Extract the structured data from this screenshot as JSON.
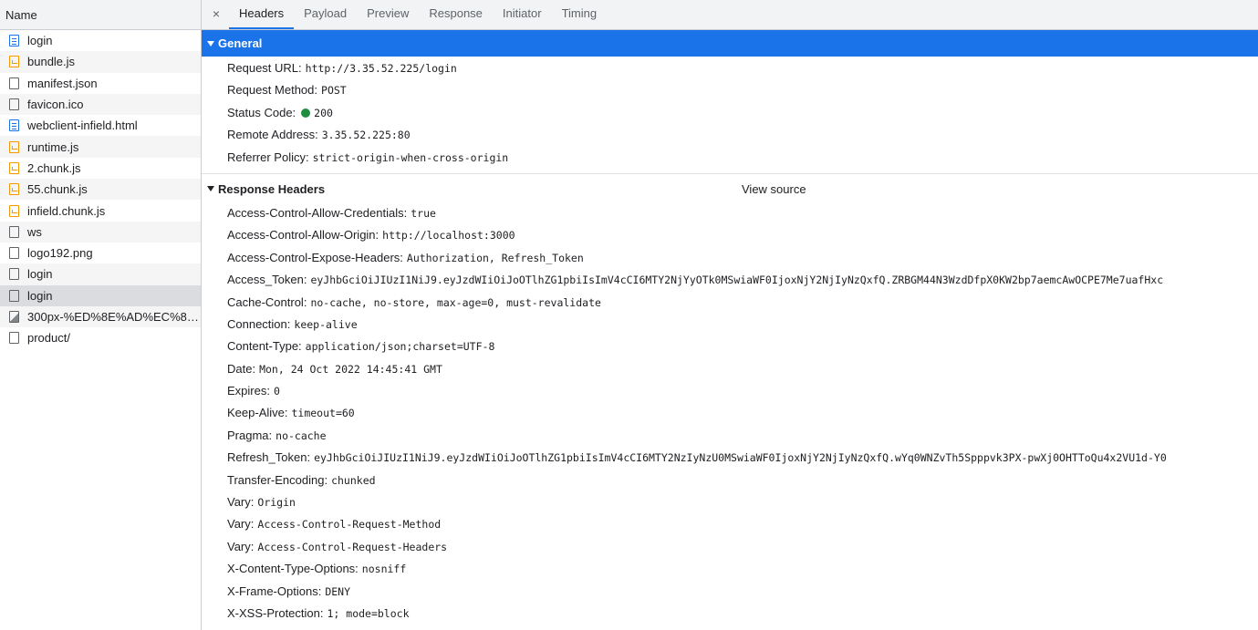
{
  "left": {
    "header": "Name",
    "items": [
      {
        "name": "login",
        "type": "doc"
      },
      {
        "name": "bundle.js",
        "type": "js"
      },
      {
        "name": "manifest.json",
        "type": "blank"
      },
      {
        "name": "favicon.ico",
        "type": "blank"
      },
      {
        "name": "webclient-infield.html",
        "type": "doc"
      },
      {
        "name": "runtime.js",
        "type": "js"
      },
      {
        "name": "2.chunk.js",
        "type": "js"
      },
      {
        "name": "55.chunk.js",
        "type": "js"
      },
      {
        "name": "infield.chunk.js",
        "type": "js"
      },
      {
        "name": "ws",
        "type": "blank"
      },
      {
        "name": "logo192.png",
        "type": "blank"
      },
      {
        "name": "login",
        "type": "blank"
      },
      {
        "name": "login",
        "type": "blank",
        "selected": true
      },
      {
        "name": "300px-%ED%8E%AD%EC%88...",
        "type": "img"
      },
      {
        "name": "product/",
        "type": "blank"
      }
    ]
  },
  "tabs": {
    "close": "×",
    "items": [
      "Headers",
      "Payload",
      "Preview",
      "Response",
      "Initiator",
      "Timing"
    ],
    "active": "Headers"
  },
  "general": {
    "title": "General",
    "rows": [
      {
        "k": "Request URL:",
        "v": "http://3.35.52.225/login"
      },
      {
        "k": "Request Method:",
        "v": "POST"
      },
      {
        "k": "Status Code:",
        "v": "200",
        "status_dot": true
      },
      {
        "k": "Remote Address:",
        "v": "3.35.52.225:80"
      },
      {
        "k": "Referrer Policy:",
        "v": "strict-origin-when-cross-origin"
      }
    ]
  },
  "response_headers": {
    "title": "Response Headers",
    "view_source": "View source",
    "rows": [
      {
        "k": "Access-Control-Allow-Credentials:",
        "v": "true"
      },
      {
        "k": "Access-Control-Allow-Origin:",
        "v": "http://localhost:3000"
      },
      {
        "k": "Access-Control-Expose-Headers:",
        "v": "Authorization, Refresh_Token"
      },
      {
        "k": "Access_Token:",
        "v": "eyJhbGciOiJIUzI1NiJ9.eyJzdWIiOiJoOTlhZG1pbiIsImV4cCI6MTY2NjYyOTk0MSwiaWF0IjoxNjY2NjIyNzQxfQ.ZRBGM44N3WzdDfpX0KW2bp7aemcAwOCPE7Me7uafHxc"
      },
      {
        "k": "Cache-Control:",
        "v": "no-cache, no-store, max-age=0, must-revalidate"
      },
      {
        "k": "Connection:",
        "v": "keep-alive"
      },
      {
        "k": "Content-Type:",
        "v": "application/json;charset=UTF-8"
      },
      {
        "k": "Date:",
        "v": "Mon, 24 Oct 2022 14:45:41 GMT"
      },
      {
        "k": "Expires:",
        "v": "0"
      },
      {
        "k": "Keep-Alive:",
        "v": "timeout=60"
      },
      {
        "k": "Pragma:",
        "v": "no-cache"
      },
      {
        "k": "Refresh_Token:",
        "v": "eyJhbGciOiJIUzI1NiJ9.eyJzdWIiOiJoOTlhZG1pbiIsImV4cCI6MTY2NzIyNzU0MSwiaWF0IjoxNjY2NjIyNzQxfQ.wYq0WNZvTh5Spppvk3PX-pwXj0OHTToQu4x2VU1d-Y0"
      },
      {
        "k": "Transfer-Encoding:",
        "v": "chunked"
      },
      {
        "k": "Vary:",
        "v": "Origin"
      },
      {
        "k": "Vary:",
        "v": "Access-Control-Request-Method"
      },
      {
        "k": "Vary:",
        "v": "Access-Control-Request-Headers"
      },
      {
        "k": "X-Content-Type-Options:",
        "v": "nosniff"
      },
      {
        "k": "X-Frame-Options:",
        "v": "DENY"
      },
      {
        "k": "X-XSS-Protection:",
        "v": "1; mode=block"
      }
    ]
  },
  "colors": {
    "accent": "#1a73e8",
    "status_ok": "#1e8e3e",
    "js_icon": "#f29900",
    "doc_icon": "#1a73e8"
  }
}
